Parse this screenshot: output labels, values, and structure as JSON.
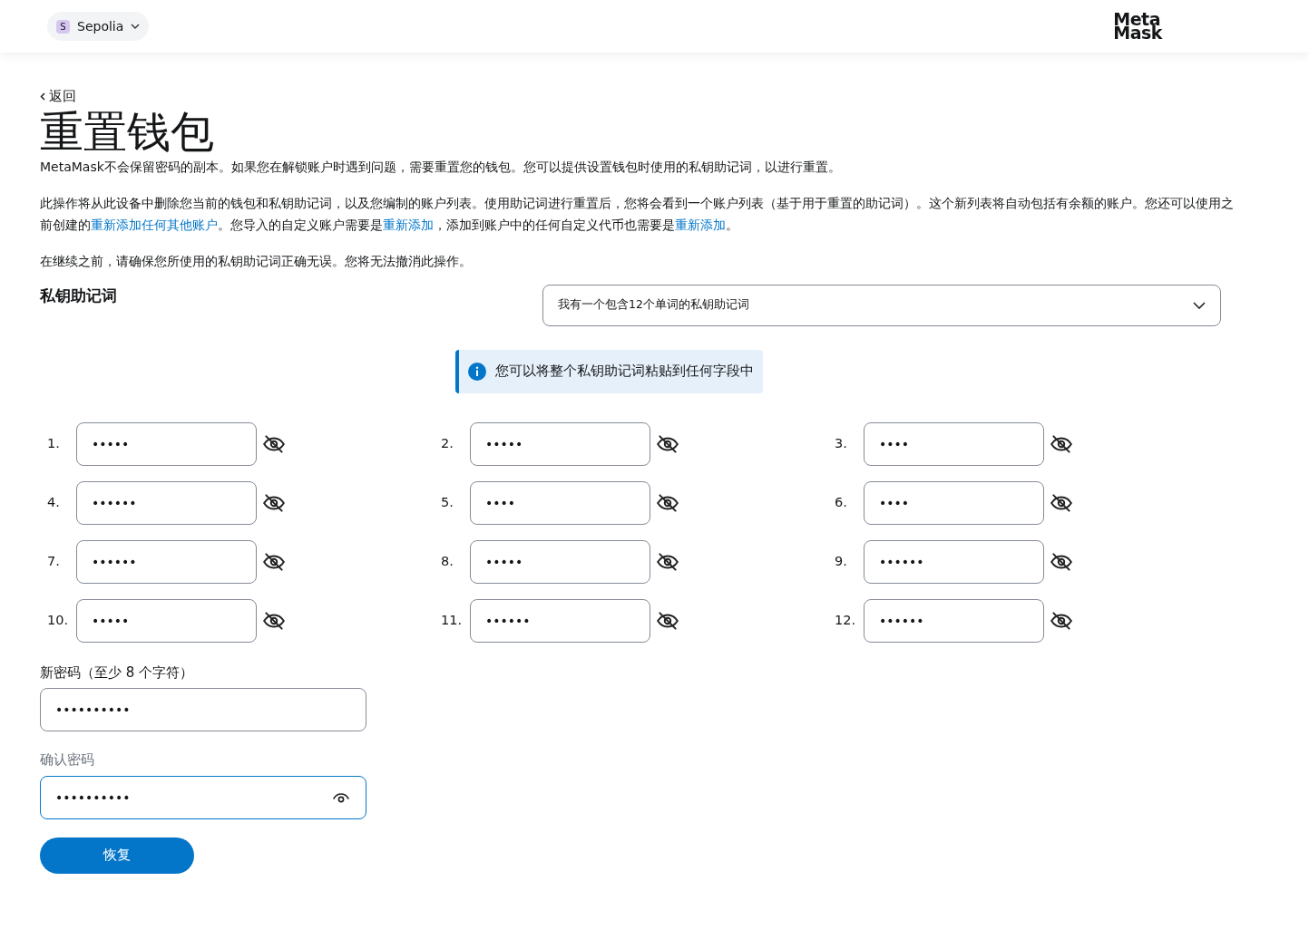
{
  "header": {
    "network": {
      "initial": "S",
      "name": "Sepolia"
    },
    "logo": [
      "Meta",
      "Mask"
    ]
  },
  "back_link": "返回",
  "title": "重置钱包",
  "paragraphs": [
    [
      {
        "text": "MetaMask不会保留密码的副本。如果您在解锁账户时遇到问题，需要重置您的钱包。您可以提供设置钱包时使用的私钥助记词，以进行重置。",
        "link": false
      }
    ],
    [
      {
        "text": "此操作将从此设备中删除您当前的钱包和私钥助记词，以及您编制的账户列表。使用助记词进行重置后，您将会看到一个账户列表（基于用于重置的助记词）。这个新列表将自动包括有余额的账户。您还可以使用之前创建的",
        "link": false
      },
      {
        "text": "重新添加任何其他账户",
        "link": true
      },
      {
        "text": "。您导入的自定义账户需要是",
        "link": false
      },
      {
        "text": "重新添加",
        "link": true
      },
      {
        "text": "，添加到账户中的任何自定义代币也需要是",
        "link": false
      },
      {
        "text": "重新添加",
        "link": true
      },
      {
        "text": "。",
        "link": false
      }
    ],
    [
      {
        "text": "在继续之前，请确保您所使用的私钥助记词正确无误。您将无法撤消此操作。",
        "link": false
      }
    ]
  ],
  "srp": {
    "label": "私钥助记词",
    "dropdown": "我有一个包含12个单词的私钥助记词",
    "info": "您可以将整个私钥助记词粘贴到任何字段中",
    "words": [
      {
        "number": "1.",
        "value": "•••••",
        "hidden": true
      },
      {
        "number": "2.",
        "value": "•••••",
        "hidden": true
      },
      {
        "number": "3.",
        "value": "••••",
        "hidden": true
      },
      {
        "number": "4.",
        "value": "••••••",
        "hidden": true
      },
      {
        "number": "5.",
        "value": "••••",
        "hidden": true
      },
      {
        "number": "6.",
        "value": "••••",
        "hidden": true
      },
      {
        "number": "7.",
        "value": "••••••",
        "hidden": true
      },
      {
        "number": "8.",
        "value": "•••••",
        "hidden": true
      },
      {
        "number": "9.",
        "value": "••••••",
        "hidden": true
      },
      {
        "number": "10.",
        "value": "•••••",
        "hidden": true
      },
      {
        "number": "11.",
        "value": "••••••",
        "hidden": true
      },
      {
        "number": "12.",
        "value": "••••••",
        "hidden": true
      }
    ]
  },
  "password_fields": [
    {
      "label": "新密码（至少 8 个字符）",
      "value": "••••••••••",
      "focused": false,
      "show_toggle": false
    },
    {
      "label": "确认密码",
      "value": "••••••••••",
      "focused": true,
      "show_toggle": true
    }
  ],
  "restore_button": "恢复"
}
